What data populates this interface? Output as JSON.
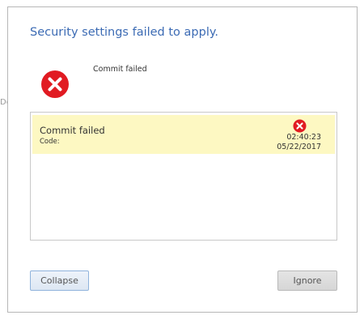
{
  "background": {
    "fragment": "De"
  },
  "dialog": {
    "title": "Security settings failed to apply.",
    "summary_message": "Commit failed",
    "summary_icon": "error-icon"
  },
  "details": {
    "rows": [
      {
        "title": "Commit failed",
        "code_label": "Code:",
        "icon": "error-icon",
        "time": "02:40:23",
        "date": "05/22/2017"
      }
    ]
  },
  "buttons": {
    "collapse_label": "Collapse",
    "ignore_label": "Ignore"
  },
  "colors": {
    "title": "#3c6bb4",
    "error_red": "#e11b22",
    "row_highlight": "#fdf8c2"
  }
}
